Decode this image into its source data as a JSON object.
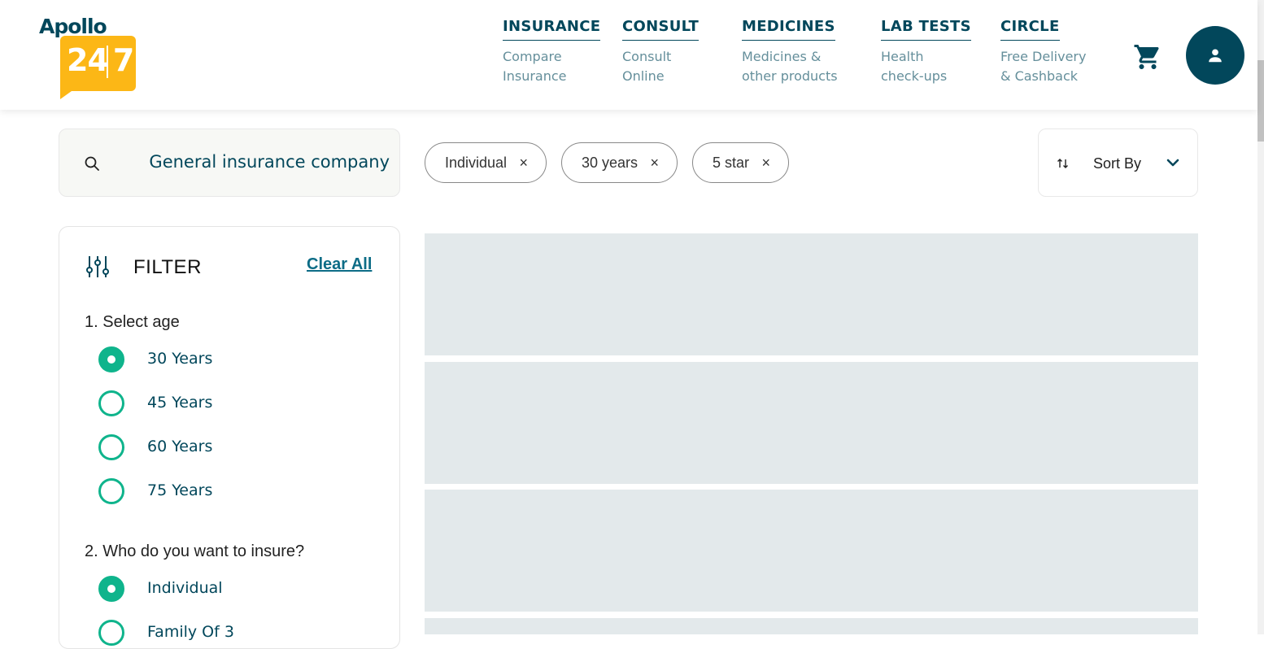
{
  "header": {
    "logo": {
      "word": "Apollo",
      "number": "24|7"
    },
    "nav": [
      {
        "title": "INSURANCE",
        "sub": "Compare\nInsurance"
      },
      {
        "title": "CONSULT",
        "sub": "Consult\nOnline"
      },
      {
        "title": "MEDICINES",
        "sub": "Medicines &\nother products"
      },
      {
        "title": "LAB TESTS",
        "sub": "Health\ncheck-ups"
      },
      {
        "title": "CIRCLE",
        "sub": "Free Delivery\n& Cashback"
      }
    ],
    "icons": {
      "cart": "cart-icon",
      "account": "user-icon"
    }
  },
  "search": {
    "value": "General insurance company",
    "icon": "search-icon"
  },
  "chips": [
    {
      "label": "Individual",
      "remove": "×"
    },
    {
      "label": "30 years",
      "remove": "×"
    },
    {
      "label": "5 star",
      "remove": "×"
    }
  ],
  "sort": {
    "label": "Sort By"
  },
  "filter": {
    "title": "FILTER",
    "clear_all": "Clear All",
    "q1": {
      "title": "1. Select age",
      "options": [
        "30 Years",
        "45 Years",
        "60 Years",
        "75 Years"
      ],
      "selected": "30 Years"
    },
    "q2": {
      "title": "2. Who do you want to insure?",
      "options": [
        "Individual",
        "Family Of 3"
      ],
      "selected": "Individual"
    }
  },
  "colors": {
    "brand_dark": "#02475b",
    "accent_green": "#0fb48c",
    "logo_yellow": "#fcb716",
    "skeleton": "#e3e9eb"
  }
}
